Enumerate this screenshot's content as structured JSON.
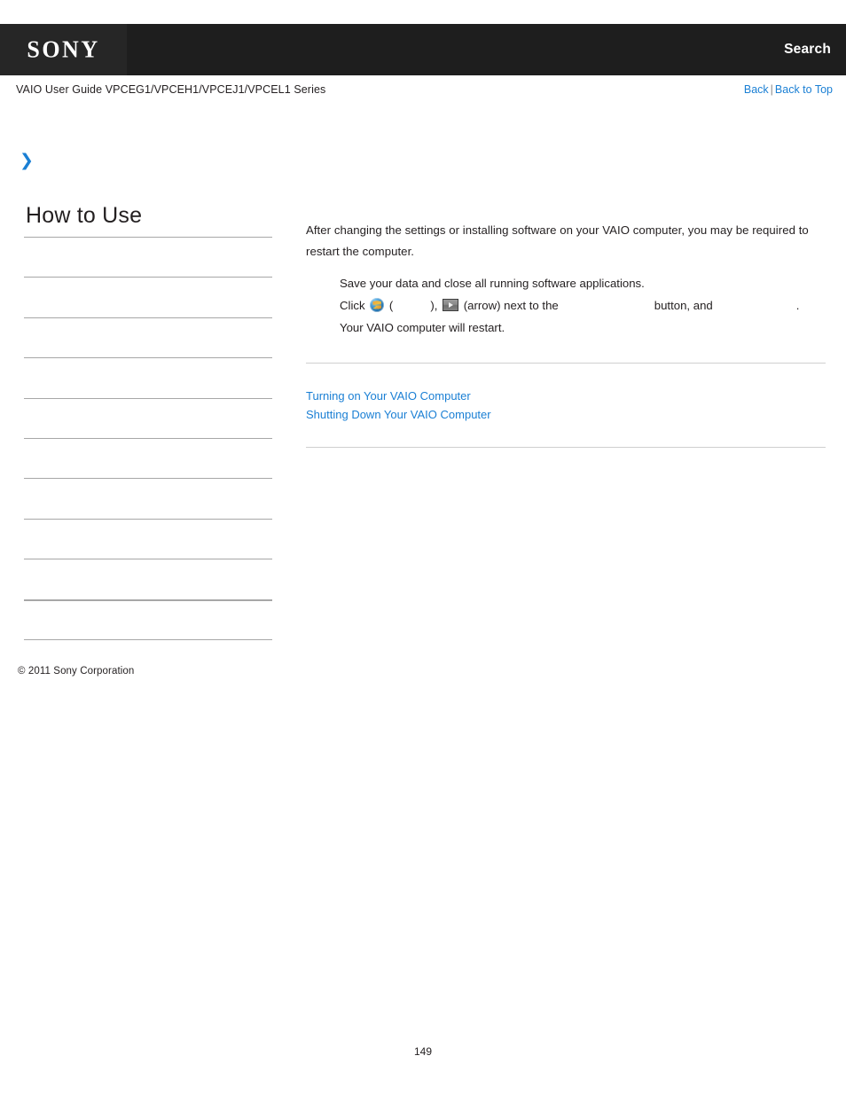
{
  "header": {
    "logo_text": "SONY",
    "search_label": "Search",
    "logo_block_color": "#262626",
    "band_color": "#1e1e1e"
  },
  "subheader": {
    "guide_title": "VAIO User Guide VPCEG1/VPCEH1/VPCEJ1/VPCEL1 Series",
    "back_label": "Back",
    "separator": "|",
    "back_to_top_label": "Back to Top",
    "link_color": "#1a7fd4"
  },
  "breadcrumb": {
    "chevron": "❯"
  },
  "sidebar": {
    "title": "How to Use",
    "items": [
      {
        "label": ""
      },
      {
        "label": ""
      },
      {
        "label": ""
      },
      {
        "label": ""
      },
      {
        "label": ""
      },
      {
        "label": ""
      },
      {
        "label": ""
      },
      {
        "label": ""
      },
      {
        "label": ""
      },
      {
        "label": ""
      },
      {
        "label": ""
      }
    ]
  },
  "content": {
    "intro": "After changing the settings or installing software on your VAIO computer, you may be required to restart the computer.",
    "steps": [
      {
        "text": "Save your data and close all running software applications."
      },
      {
        "prefix": "Click",
        "orb_icon": "windows-start-orb-icon",
        "open_paren": "(",
        "hidden_term_1": "",
        "close_paren": "),",
        "arrow_icon": "arrow-button-icon",
        "arrow_note": "(arrow) next to the",
        "hidden_term_2": "",
        "mid": "button, and",
        "hidden_term_3": "",
        "period": "."
      },
      {
        "text": "Your VAIO computer will restart."
      }
    ],
    "related_links": [
      "Turning on Your VAIO Computer",
      "Shutting Down Your VAIO Computer"
    ]
  },
  "footer": {
    "copyright": "© 2011 Sony Corporation",
    "page_number": "149"
  }
}
